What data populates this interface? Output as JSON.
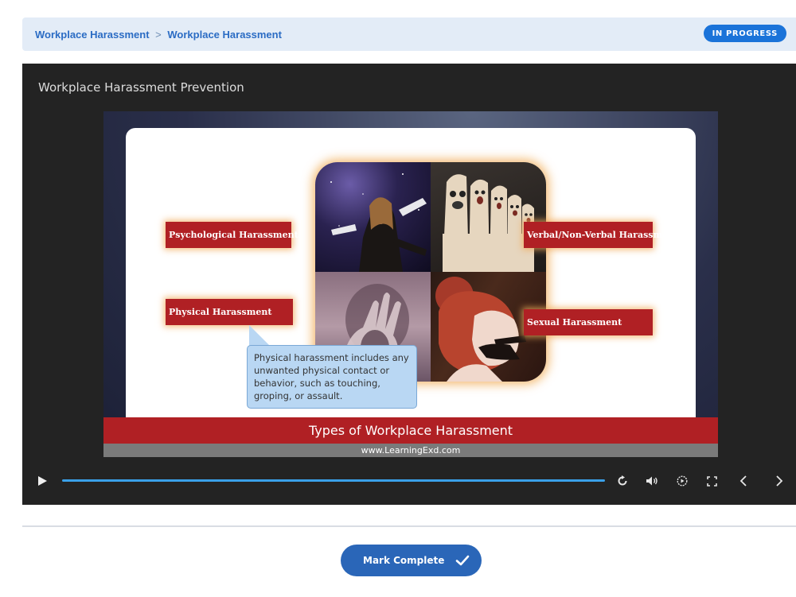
{
  "breadcrumb": {
    "parent": "Workplace Harassment",
    "separator": ">",
    "current": "Workplace Harassment"
  },
  "status": {
    "label": "IN PROGRESS",
    "color": "#1a73d9"
  },
  "video": {
    "title": "Workplace Harassment Prevention",
    "slide": {
      "labels": {
        "psychological": "Psychological Harassment",
        "verbal": "Verbal/Non-Verbal Harassment",
        "physical": "Physical Harassment",
        "sexual": "Sexual Harassment"
      },
      "callout": "Physical harassment includes any unwanted physical contact or behavior, such as touching, groping, or assault.",
      "banner": "Types of Workplace Harassment",
      "footer": "www.LearningExd.com"
    },
    "progress": 1.0,
    "controls": [
      "play-icon",
      "replay-icon",
      "volume-icon",
      "playback-speed-icon",
      "fullscreen-icon",
      "previous-icon",
      "next-icon"
    ]
  },
  "actions": {
    "mark_complete": "Mark Complete"
  },
  "colors": {
    "accent": "#2a66b8",
    "slide_red": "#b02024",
    "progress": "#3aa0e8"
  }
}
